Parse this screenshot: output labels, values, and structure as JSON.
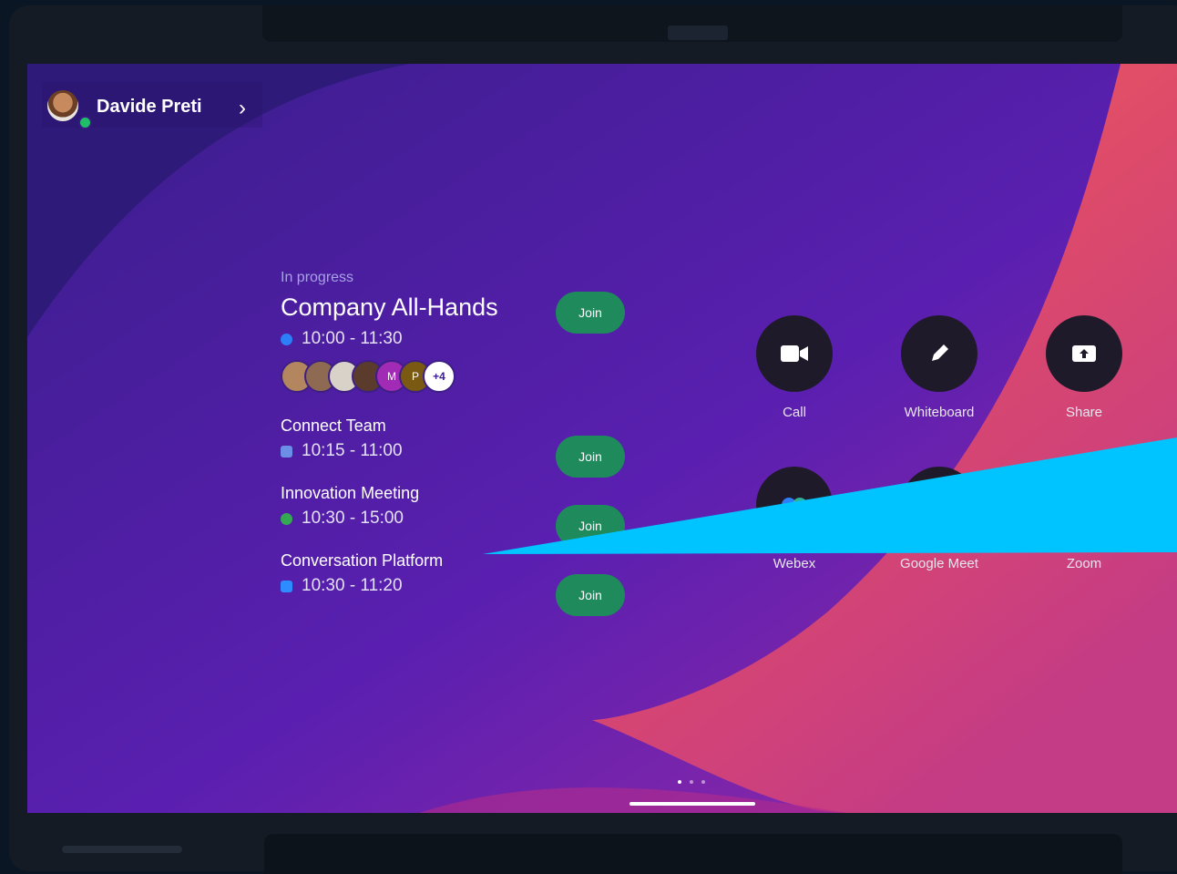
{
  "user": {
    "name": "Davide Preti"
  },
  "meetings": {
    "status_label": "In progress",
    "items": [
      {
        "title": "Company All-Hands",
        "time": "10:00 - 11:30",
        "join_label": "Join",
        "service_color": "#2d7ff9"
      },
      {
        "title": "Connect Team",
        "time": "10:15 - 11:00",
        "join_label": "Join",
        "service_color": "#6c8ee6"
      },
      {
        "title": "Innovation Meeting",
        "time": "10:30 - 15:00",
        "join_label": "Join",
        "service_color": "#34a853"
      },
      {
        "title": "Conversation Platform",
        "time": "10:30 - 11:20",
        "join_label": "Join",
        "service_color": "#2d8cff"
      }
    ],
    "attendees": [
      {
        "initial": "",
        "color": "#b3865f"
      },
      {
        "initial": "",
        "color": "#8e6a52"
      },
      {
        "initial": "",
        "color": "#d9d2c8"
      },
      {
        "initial": "",
        "color": "#5a3b2c"
      },
      {
        "initial": "M",
        "color": "#a22bb5"
      },
      {
        "initial": "P",
        "color": "#7a5a12"
      },
      {
        "initial": "+4",
        "color": "#ffffff"
      }
    ]
  },
  "apps": [
    {
      "label": "Call",
      "icon": "video-camera-icon"
    },
    {
      "label": "Whiteboard",
      "icon": "pencil-icon"
    },
    {
      "label": "Share",
      "icon": "share-screen-icon"
    },
    {
      "label": "Webex",
      "icon": "webex-icon"
    },
    {
      "label": "Google Meet",
      "icon": "google-meet-icon"
    },
    {
      "label": "Zoom",
      "icon": "zoom-icon"
    }
  ],
  "colors": {
    "join_button": "#1f8a5c",
    "overlay_highlight": "#00c4ff",
    "bg_purple": "#4a1fa0",
    "bg_coral": "#e8555c"
  }
}
